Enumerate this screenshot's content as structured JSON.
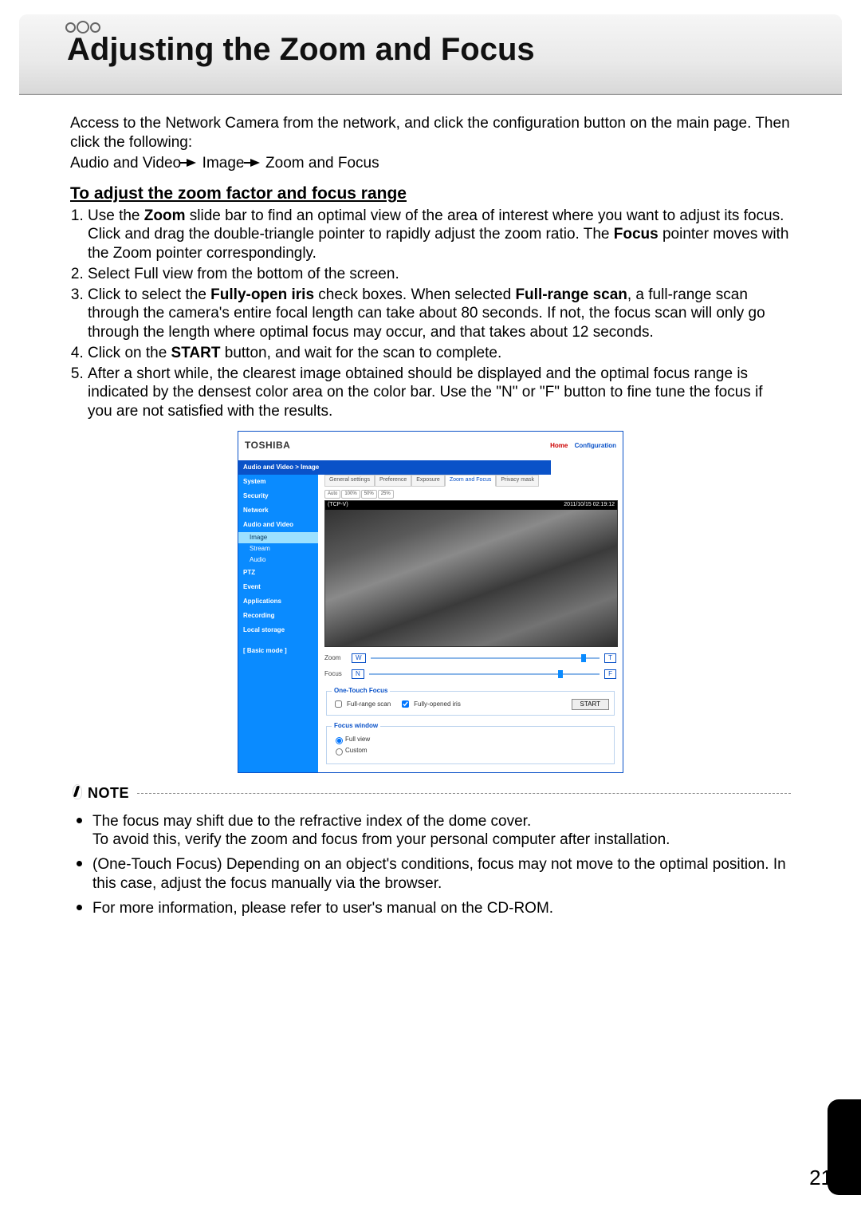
{
  "header": {
    "title": "Adjusting the Zoom and Focus"
  },
  "intro": {
    "p1": "Access to the Network Camera from the network, and click the configuration button on the main page. Then click the following:",
    "path1": "Audio and Video",
    "path2": "Image",
    "path3": "Zoom and Focus"
  },
  "sub_heading": "To adjust the zoom factor and focus range",
  "steps": [
    {
      "pre": "Use the ",
      "b1": "Zoom",
      "mid": " slide bar to find an optimal view of the area of interest where you want to adjust its focus. Click and drag the double-triangle pointer to rapidly adjust the zoom ratio. The ",
      "b2": "Focus",
      "post": " pointer moves with the Zoom pointer correspondingly."
    },
    {
      "text": "Select Full view from the bottom of the screen."
    },
    {
      "pre": "Click to select the ",
      "b1": "Fully-open iris",
      "mid": " check boxes. When selected ",
      "b2": "Full-range scan",
      "post": ", a full-range scan through the camera's entire focal length can take about 80 seconds. If not, the focus scan will only go through the length where optimal focus may occur, and that takes about 12 seconds."
    },
    {
      "pre": "Click on the ",
      "b1": "START",
      "post": " button, and wait for the scan to complete."
    },
    {
      "text": "After a short while, the clearest image obtained should be displayed and the optimal focus range is indicated by the densest color area on the color bar. Use the \"N\" or \"F\" button to fine tune the focus if you are not satisfied with the results."
    }
  ],
  "shot": {
    "brand": "TOSHIBA",
    "links": {
      "home": "Home",
      "config": "Configuration"
    },
    "breadcrumb": "Audio and Video  >  Image",
    "sidebar": [
      "System",
      "Security",
      "Network",
      "Audio and Video"
    ],
    "sidebar_sub": [
      "Image",
      "Stream",
      "Audio"
    ],
    "sidebar2": [
      "PTZ",
      "Event",
      "Applications",
      "Recording",
      "Local storage"
    ],
    "basic_mode": "[ Basic mode ]",
    "tabs": [
      "General settings",
      "Preference",
      "Exposure",
      "Zoom and Focus",
      "Privacy mask"
    ],
    "zoombtns": [
      "Auto",
      "100%",
      "50%",
      "25%"
    ],
    "overlay": {
      "left": "(TCP-V)",
      "right": "2011/10/15 02:19:12"
    },
    "zoom": {
      "label": "Zoom",
      "w": "W",
      "t": "T"
    },
    "focus": {
      "label": "Focus",
      "n": "N",
      "f": "F"
    },
    "otf": {
      "legend": "One-Touch Focus",
      "full_range": "Full-range scan",
      "full_range_checked": false,
      "iris": "Fully-opened iris",
      "iris_checked": true,
      "start": "START"
    },
    "fw": {
      "legend": "Focus window",
      "full": "Full view",
      "custom": "Custom",
      "selected": "full"
    }
  },
  "note": {
    "label": "NOTE",
    "items": [
      "The focus may shift due to the refractive index of the dome cover.\nTo avoid this, verify the zoom and focus from your personal computer after installation.",
      "(One-Touch Focus) Depending on an object's conditions, focus may not move to the optimal position. In this case, adjust the focus manually via the browser.",
      "For more information, please refer to user's manual on the CD-ROM."
    ]
  },
  "page_number": "21"
}
